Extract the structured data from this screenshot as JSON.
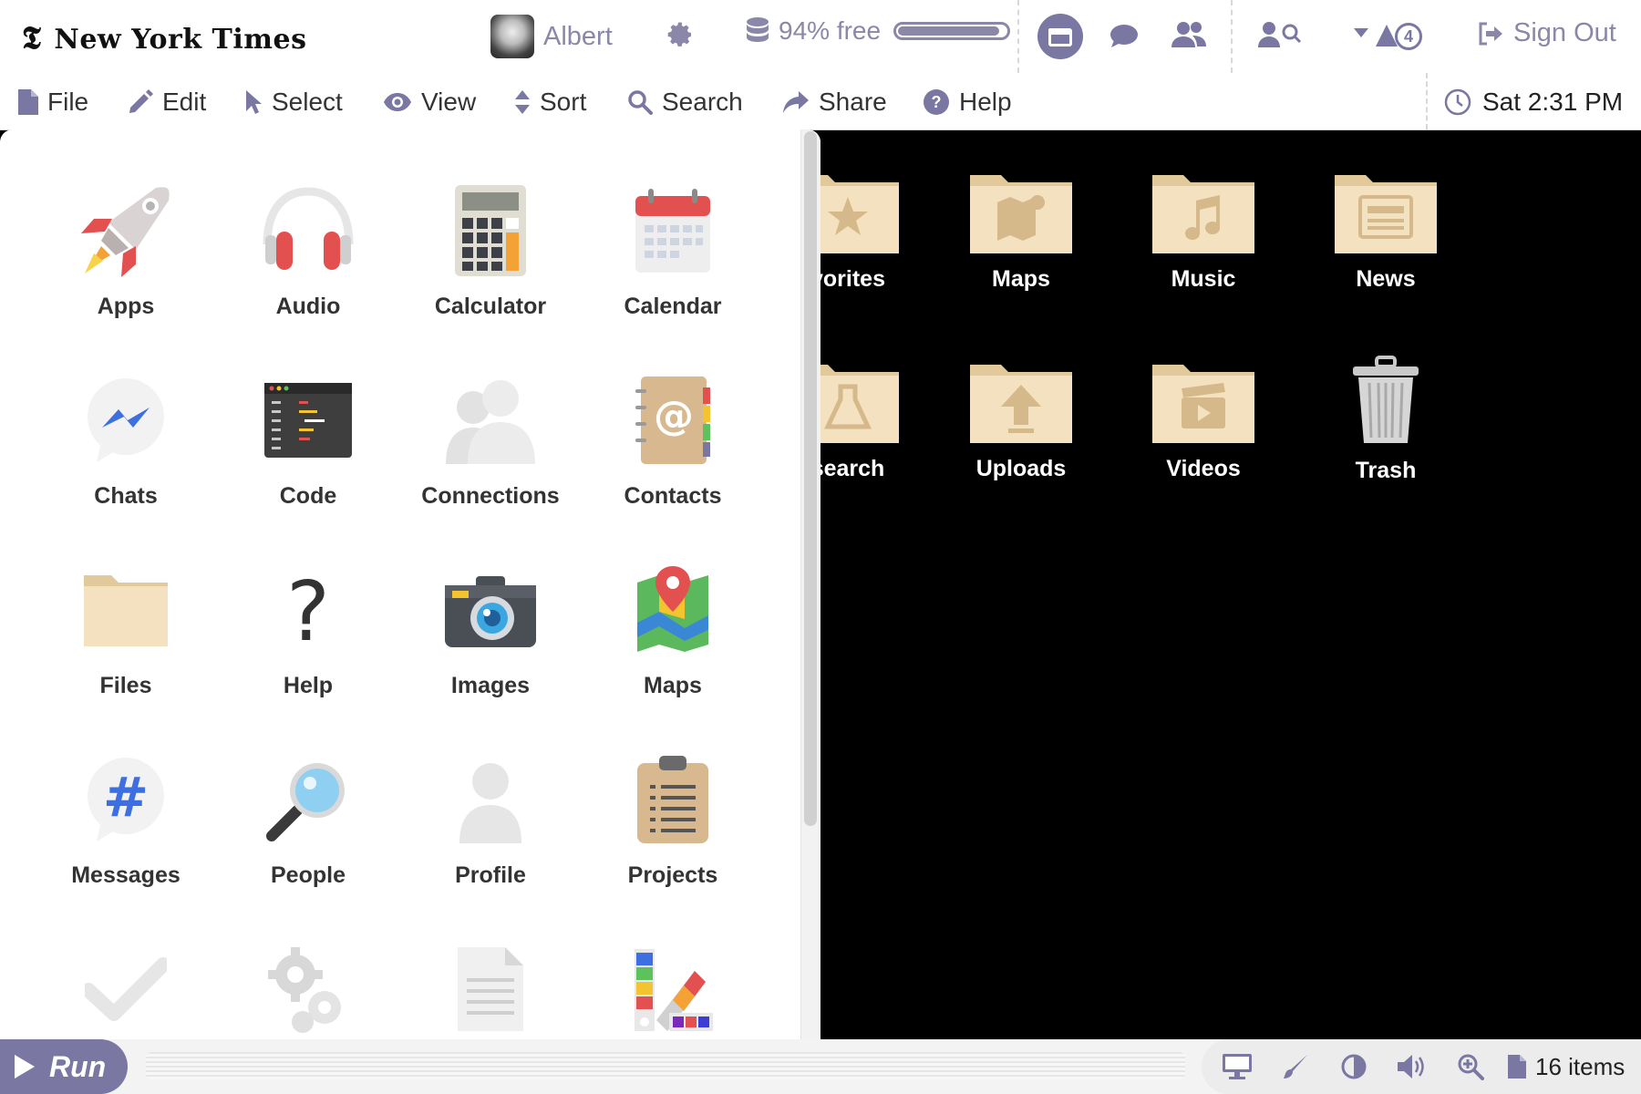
{
  "header": {
    "logo": "New York Times",
    "user_name": "Albert",
    "storage_text": "94% free",
    "storage_free_percent": 94,
    "notification_count": "4",
    "sign_out": "Sign Out"
  },
  "menu": {
    "file": "File",
    "edit": "Edit",
    "select": "Select",
    "view": "View",
    "sort": "Sort",
    "search": "Search",
    "share": "Share",
    "help": "Help",
    "clock": "Sat 2:31 PM"
  },
  "desktop": {
    "row1": [
      "vorites",
      "Maps",
      "Music",
      "News"
    ],
    "row2": [
      "search",
      "Uploads",
      "Videos",
      "Trash"
    ]
  },
  "launcher": {
    "apps": [
      "Apps",
      "Audio",
      "Calculator",
      "Calendar",
      "Chats",
      "Code",
      "Connections",
      "Contacts",
      "Files",
      "Help",
      "Images",
      "Maps",
      "Messages",
      "People",
      "Profile",
      "Projects"
    ]
  },
  "bottombar": {
    "run": "Run",
    "items_count": "16 items"
  },
  "colors": {
    "accent": "#7a77a3",
    "folder": "#f3e1bf",
    "folder_dark": "#e2c99b"
  }
}
